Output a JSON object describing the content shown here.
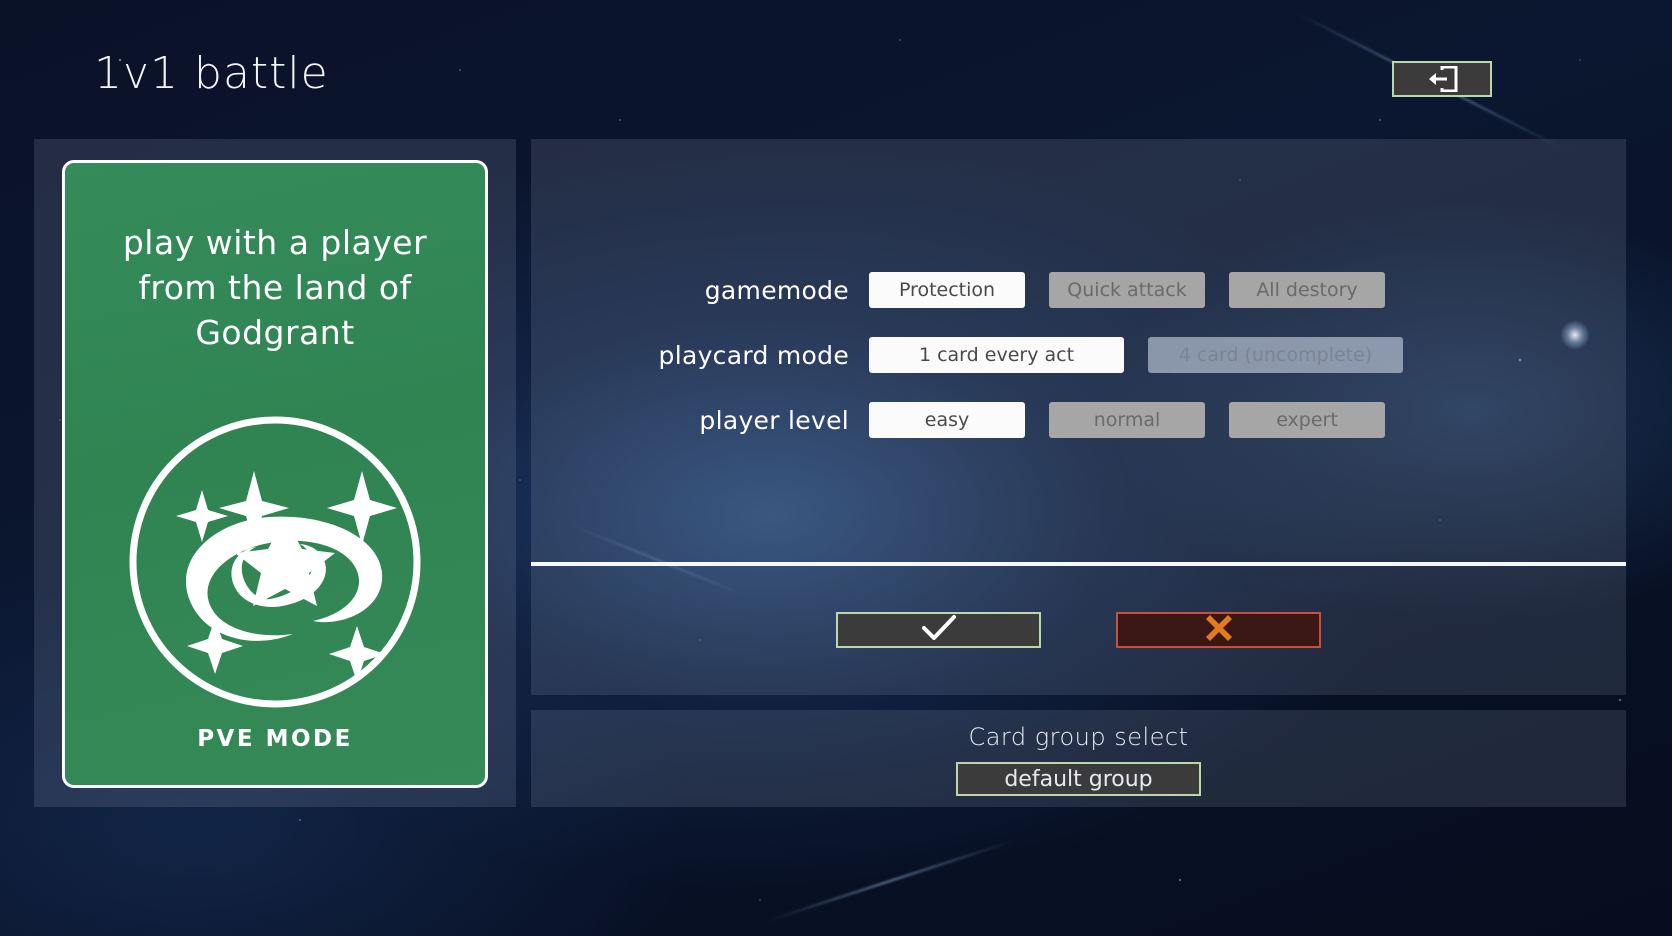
{
  "header": {
    "title": "1v1 battle",
    "exit_icon": "exit-icon"
  },
  "card": {
    "description": "play with a player from the land of Godgrant",
    "emblem_icon": "galaxy-swirl-stars-emblem",
    "mode_label": "PVE MODE"
  },
  "settings": {
    "rows": [
      {
        "label": "gamemode",
        "options": [
          {
            "label": "Protection",
            "state": "selected"
          },
          {
            "label": "Quick attack",
            "state": "normal"
          },
          {
            "label": "All destory",
            "state": "normal"
          }
        ]
      },
      {
        "label": "playcard mode",
        "options": [
          {
            "label": "1 card every act",
            "state": "selected"
          },
          {
            "label": "4 card (uncomplete)",
            "state": "disabled"
          }
        ]
      },
      {
        "label": "player level",
        "options": [
          {
            "label": "easy",
            "state": "selected"
          },
          {
            "label": "normal",
            "state": "normal"
          },
          {
            "label": "expert",
            "state": "normal"
          }
        ]
      }
    ],
    "confirm_icon": "checkmark-icon",
    "cancel_icon": "cross-icon"
  },
  "card_group": {
    "title": "Card group select",
    "selected_group": "default group"
  },
  "colors": {
    "card_green": "#358b5a",
    "accent_border_green": "#bcd7a8",
    "cancel_border_red": "#c6503c",
    "cancel_icon_orange": "#e07b1e",
    "selected_button": "#fbfbfb",
    "normal_button": "#a6a6a6"
  }
}
